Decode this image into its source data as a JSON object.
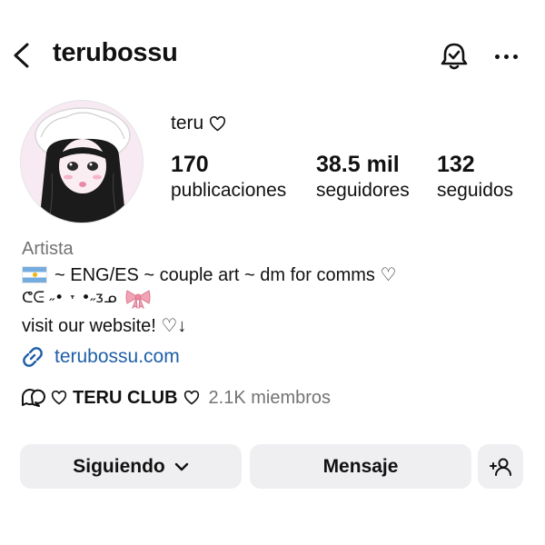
{
  "header": {
    "username": "terubossu"
  },
  "profile": {
    "display_name": "teru",
    "stats": [
      {
        "number": "170",
        "label": "publicaciones"
      },
      {
        "number": "38.5 mil",
        "label": "seguidores"
      },
      {
        "number": "132",
        "label": "seguidos"
      }
    ],
    "category": "Artista",
    "bio": {
      "line1": "~ ENG/ES ~ couple art ~ dm for comms ♡",
      "line2": "ᕦᕮ ˶• ˕ •˶ᴣᓄ",
      "line3": "visit our website! ♡↓"
    },
    "link": "terubossu.com",
    "channel": {
      "name": "TERU CLUB",
      "members": "2.1K miembros"
    }
  },
  "actions": {
    "following_label": "Siguiendo",
    "message_label": "Mensaje"
  },
  "icons": [
    "back-icon",
    "bell-icon",
    "more-icon",
    "heart-icon",
    "argentina-flag-icon",
    "bow-icon",
    "link-icon",
    "channel-icon",
    "chevron-down-icon",
    "add-user-icon"
  ],
  "colors": {
    "link": "#1f5fa8",
    "muted": "#737373",
    "button_bg": "#efeff2",
    "bow": "#f3a3b6"
  }
}
